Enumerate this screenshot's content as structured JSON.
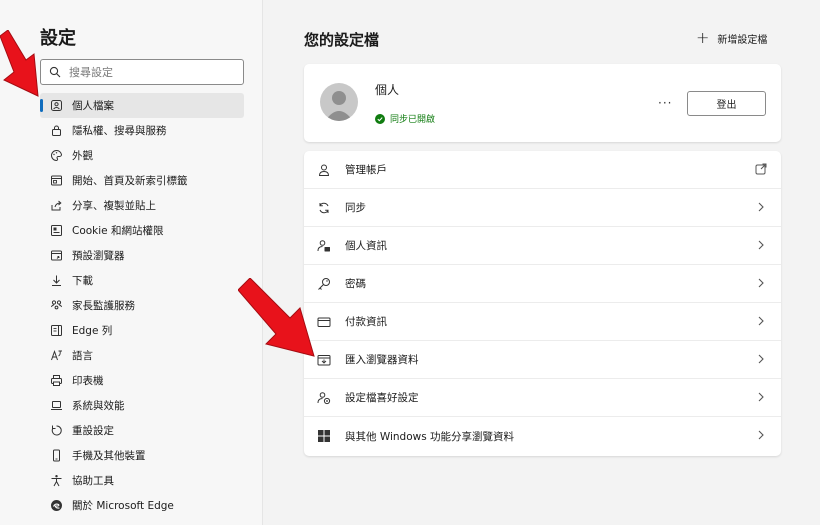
{
  "sidebar": {
    "title": "設定",
    "search_placeholder": "搜尋設定",
    "items": [
      {
        "label": "個人檔案",
        "icon": "profile-icon"
      },
      {
        "label": "隱私權、搜尋與服務",
        "icon": "lock-icon"
      },
      {
        "label": "外觀",
        "icon": "appearance-icon"
      },
      {
        "label": "開始、首頁及新索引標籤",
        "icon": "home-icon"
      },
      {
        "label": "分享、複製並貼上",
        "icon": "share-icon"
      },
      {
        "label": "Cookie 和網站權限",
        "icon": "cookie-icon"
      },
      {
        "label": "預設瀏覽器",
        "icon": "browser-icon"
      },
      {
        "label": "下載",
        "icon": "download-icon"
      },
      {
        "label": "家長監護服務",
        "icon": "family-icon"
      },
      {
        "label": "Edge 列",
        "icon": "edge-bar-icon"
      },
      {
        "label": "語言",
        "icon": "language-icon"
      },
      {
        "label": "印表機",
        "icon": "printer-icon"
      },
      {
        "label": "系統與效能",
        "icon": "system-icon"
      },
      {
        "label": "重設設定",
        "icon": "reset-icon"
      },
      {
        "label": "手機及其他裝置",
        "icon": "phone-icon"
      },
      {
        "label": "協助工具",
        "icon": "accessibility-icon"
      },
      {
        "label": "關於 Microsoft Edge",
        "icon": "edge-logo-icon"
      }
    ],
    "active_index": 0
  },
  "main": {
    "title": "您的設定檔",
    "add_profile_label": "新增設定檔",
    "profile": {
      "name": "個人",
      "sync_status": "同步已開啟",
      "more_label": "···",
      "signout_label": "登出"
    },
    "settings": [
      {
        "label": "管理帳戶",
        "icon": "account-icon",
        "trailing": "external-link-icon"
      },
      {
        "label": "同步",
        "icon": "sync-icon",
        "trailing": "chevron-right-icon"
      },
      {
        "label": "個人資訊",
        "icon": "personal-info-icon",
        "trailing": "chevron-right-icon"
      },
      {
        "label": "密碼",
        "icon": "key-icon",
        "trailing": "chevron-right-icon"
      },
      {
        "label": "付款資訊",
        "icon": "credit-card-icon",
        "trailing": "chevron-right-icon"
      },
      {
        "label": "匯入瀏覽器資料",
        "icon": "import-icon",
        "trailing": "chevron-right-icon"
      },
      {
        "label": "設定檔喜好設定",
        "icon": "profile-preferences-icon",
        "trailing": "chevron-right-icon"
      },
      {
        "label": "與其他 Windows 功能分享瀏覽資料",
        "icon": "windows-icon",
        "trailing": "chevron-right-icon"
      }
    ]
  },
  "colors": {
    "accent": "#0f6cbd",
    "sync_green": "#107c10",
    "annotation_arrow": "#e8121b"
  }
}
